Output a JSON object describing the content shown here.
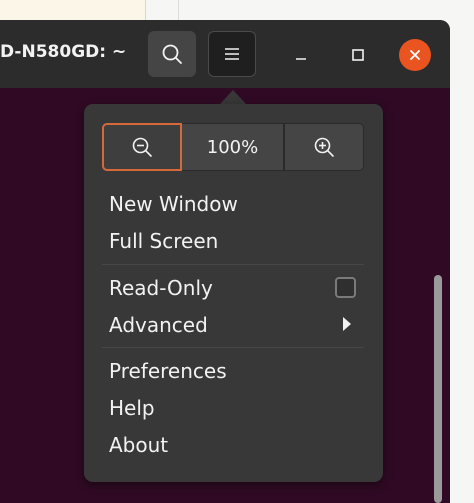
{
  "window": {
    "title": "D-N580GD: ~"
  },
  "headerbar": {
    "search_icon": "search-icon",
    "menu_icon": "hamburger-menu-icon",
    "minimize_icon": "minimize-icon",
    "maximize_icon": "maximize-icon",
    "close_icon": "close-icon"
  },
  "menu": {
    "zoom": {
      "zoom_out_icon": "zoom-out-icon",
      "level": "100%",
      "zoom_in_icon": "zoom-in-icon"
    },
    "items": [
      {
        "label": "New Window"
      },
      {
        "label": "Full Screen"
      },
      {
        "label": "Read-Only",
        "checked": false
      },
      {
        "label": "Advanced",
        "has_submenu": true
      },
      {
        "label": "Preferences"
      },
      {
        "label": "Help"
      },
      {
        "label": "About"
      }
    ]
  },
  "colors": {
    "terminal_bg": "#300a24",
    "headerbar_bg": "#2c2c2c",
    "popover_bg": "#383838",
    "close_button": "#e95420",
    "focus_outline": "#d46a3a"
  }
}
